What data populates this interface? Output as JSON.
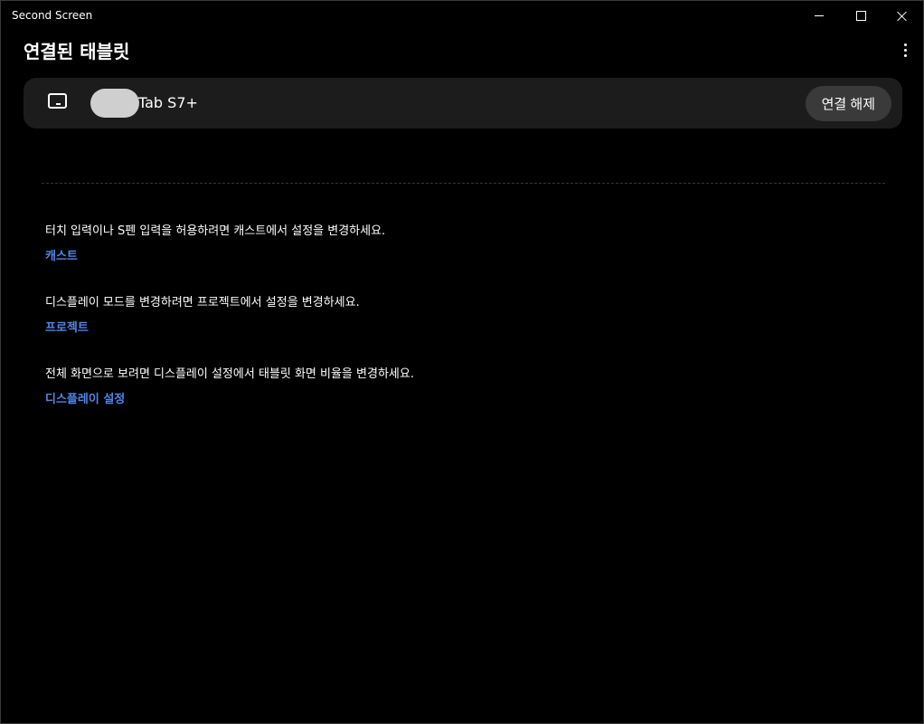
{
  "window": {
    "title": "Second Screen"
  },
  "header": {
    "title": "연결된 태블릿"
  },
  "device": {
    "name": "Tab S7+",
    "disconnect_label": "연결 해제"
  },
  "info": [
    {
      "text": "터치 입력이나 S펜 입력을 허용하려면 캐스트에서 설정을 변경하세요.",
      "link": "캐스트"
    },
    {
      "text": "디스플레이 모드를 변경하려면 프로젝트에서 설정을 변경하세요.",
      "link": "프로젝트"
    },
    {
      "text": "전체 화면으로 보려면 디스플레이 설정에서 태블릿 화면 비율을 변경하세요.",
      "link": "디스플레이 설정"
    }
  ],
  "colors": {
    "background": "#000000",
    "card": "#1c1c1c",
    "button": "#3a3a3a",
    "link": "#4f86e8"
  }
}
